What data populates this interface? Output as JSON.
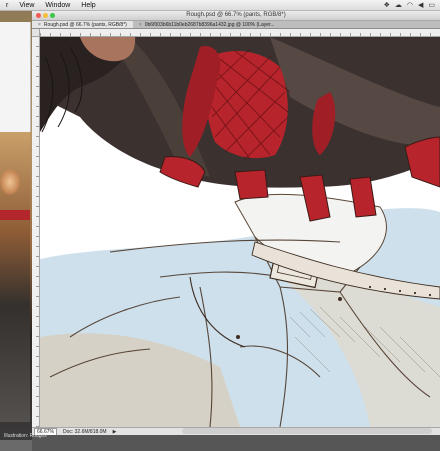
{
  "menubar": {
    "items": [
      "r",
      "View",
      "Window",
      "Help"
    ],
    "status_icons": [
      "dropbox-icon",
      "cloud-icon",
      "wifi-icon",
      "volume-icon",
      "battery-icon"
    ]
  },
  "document": {
    "window_title": "Rough.psd @ 66.7% (pants, RGB/8*)",
    "tabs": [
      {
        "label": "Rough.psd @ 66.7% (pants, RGB/8*)",
        "active": true
      },
      {
        "label": "0b6f003b6b11b0eb2687b8396a1432.jpg @ 100% (Layer...",
        "active": false
      }
    ],
    "status": {
      "zoom": "66.67%",
      "doc_size": "Doc: 32.6M/818.0M"
    }
  },
  "dock": {
    "label": "Illustration: Roughs"
  },
  "colors": {
    "jacket_red": "#b8242b",
    "jacket_dark": "#3b3230",
    "jeans_blue": "#b9d3e3",
    "line_brown": "#4a3526",
    "skin": "#a9745d"
  }
}
